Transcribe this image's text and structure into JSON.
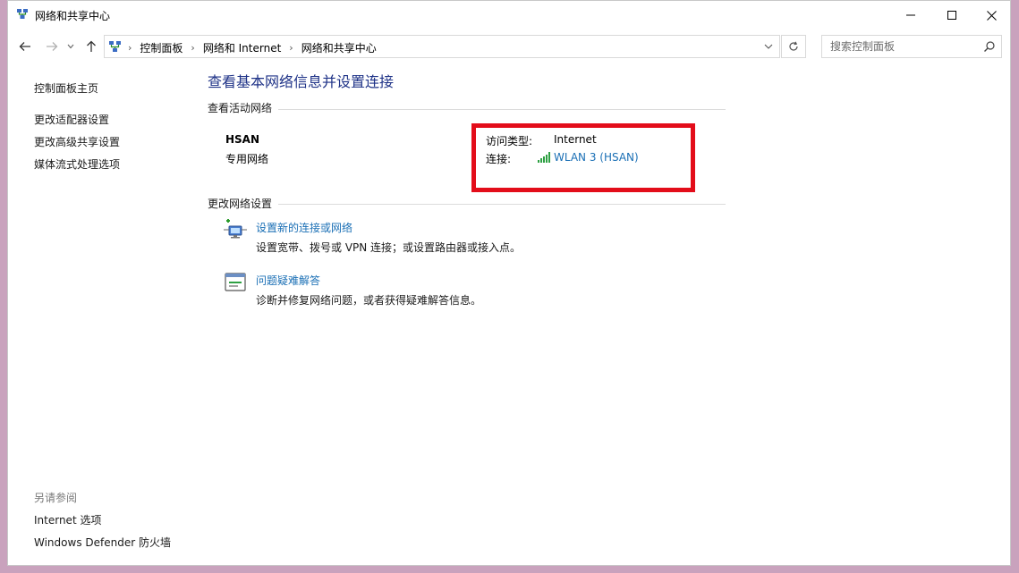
{
  "window": {
    "title": "网络和共享中心"
  },
  "address_bar": {
    "crumbs": [
      "控制面板",
      "网络和 Internet",
      "网络和共享中心"
    ]
  },
  "search": {
    "placeholder": "搜索控制面板"
  },
  "sidebar": {
    "items": [
      {
        "label": "控制面板主页"
      },
      {
        "label": "更改适配器设置"
      },
      {
        "label": "更改高级共享设置"
      },
      {
        "label": "媒体流式处理选项"
      }
    ],
    "see_also_heading": "另请参阅",
    "see_also": [
      {
        "label": "Internet 选项"
      },
      {
        "label": "Windows Defender 防火墙"
      }
    ]
  },
  "main": {
    "title": "查看基本网络信息并设置连接",
    "active_networks_heading": "查看活动网络",
    "network": {
      "name": "HSAN",
      "type": "专用网络",
      "access_type_label": "访问类型:",
      "access_type_value": "Internet",
      "connection_label": "连接:",
      "connection_value": "WLAN 3 (HSAN)"
    },
    "change_settings_heading": "更改网络设置",
    "tasks": [
      {
        "link": "设置新的连接或网络",
        "desc": "设置宽带、拨号或 VPN 连接；或设置路由器或接入点。"
      },
      {
        "link": "问题疑难解答",
        "desc": "诊断并修复网络问题，或者获得疑难解答信息。"
      }
    ]
  },
  "colors": {
    "title_blue": "#1e3287",
    "link_blue": "#1a6fb5",
    "highlight_red": "#e30d1a",
    "signal_green": "#2ea043"
  },
  "icons": {
    "app": "network-sharing-icon",
    "signal": "wifi-signal-icon"
  }
}
